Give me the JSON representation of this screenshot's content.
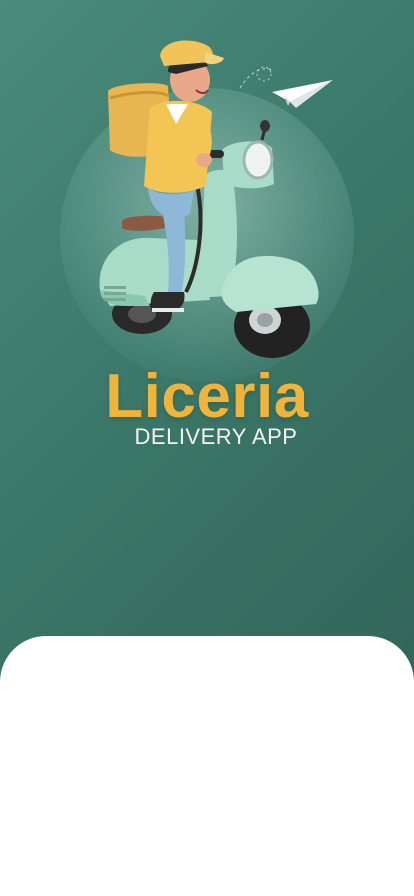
{
  "app": {
    "brand_name": "Liceria",
    "tagline": "DELIVERY APP"
  },
  "hero": {
    "illustration": "delivery-courier-on-scooter",
    "decoration": "paper-plane-icon"
  },
  "colors": {
    "background_start": "#4a8b7c",
    "background_end": "#2f5f54",
    "brand_yellow": "#f0b43c",
    "sheet": "#ffffff"
  }
}
